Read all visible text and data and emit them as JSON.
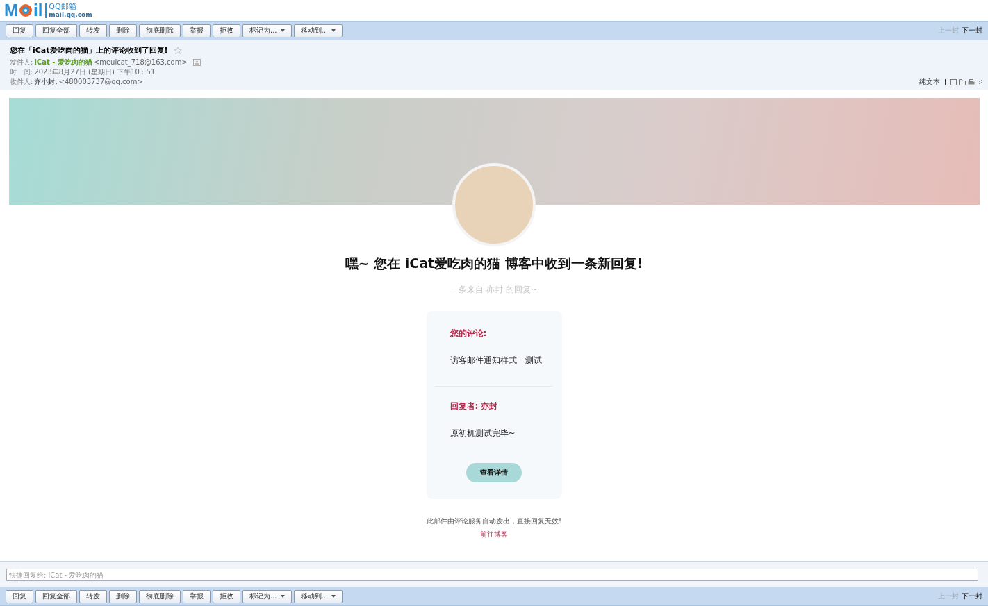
{
  "logo": {
    "before": "M",
    "after": "il",
    "product": "QQ邮箱",
    "domain": "mail.qq.com"
  },
  "toolbar": {
    "buttons": [
      {
        "label": "回复",
        "kind": "plain"
      },
      {
        "label": "回复全部",
        "kind": "plain"
      },
      {
        "label": "转发",
        "kind": "plain"
      },
      {
        "label": "删除",
        "kind": "plain"
      },
      {
        "label": "彻底删除",
        "kind": "plain"
      },
      {
        "label": "举报",
        "kind": "plain"
      },
      {
        "label": "拒收",
        "kind": "plain"
      },
      {
        "label": "标记为...",
        "kind": "dropdown"
      },
      {
        "label": "移动到...",
        "kind": "dropdown"
      }
    ],
    "nav": [
      {
        "label": "上一封",
        "disabled": true
      },
      {
        "label": "下一封",
        "disabled": false
      }
    ]
  },
  "header": {
    "subject": "您在「iCat爱吃肉的猫」上的评论收到了回复!",
    "starred": false,
    "from_label": "发件人:",
    "from_name": "iCat - 爱吃肉的猫",
    "from_address": "<meuicat_718@163.com>",
    "time_label": "时　间:",
    "time": "2023年8月27日 (星期日) 下午10 : 51",
    "to_label": "收件人:",
    "to_name": "亦小封.",
    "to_address": "<480003737@qq.com>",
    "plain_text": "纯文本"
  },
  "body": {
    "headline": "嘿~ 您在 iCat爱吃肉的猫 博客中收到一条新回复!",
    "subheadline": "一条来自 亦封 的回复~",
    "comment_label": "您的评论:",
    "comment": "访客邮件通知样式一测试",
    "reply_label": "回复者: 亦封",
    "reply": "原初机测试完毕~",
    "details_button": "查看详情",
    "footer_note": "此邮件由评论服务自动发出，直接回复无效!",
    "footer_link": "前往博客"
  },
  "quick_reply": {
    "placeholder": "快捷回复给: iCat - 爱吃肉的猫"
  },
  "bottom_toolbar": {
    "buttons": [
      {
        "label": "回复",
        "kind": "plain"
      },
      {
        "label": "回复全部",
        "kind": "plain"
      },
      {
        "label": "转发",
        "kind": "plain"
      },
      {
        "label": "删除",
        "kind": "plain"
      },
      {
        "label": "彻底删除",
        "kind": "plain"
      },
      {
        "label": "举报",
        "kind": "plain"
      },
      {
        "label": "拒收",
        "kind": "plain"
      },
      {
        "label": "标记为...",
        "kind": "dropdown"
      },
      {
        "label": "移动到...",
        "kind": "dropdown"
      }
    ],
    "nav": [
      {
        "label": "上一封",
        "disabled": true
      },
      {
        "label": "下一封",
        "disabled": false
      }
    ]
  }
}
